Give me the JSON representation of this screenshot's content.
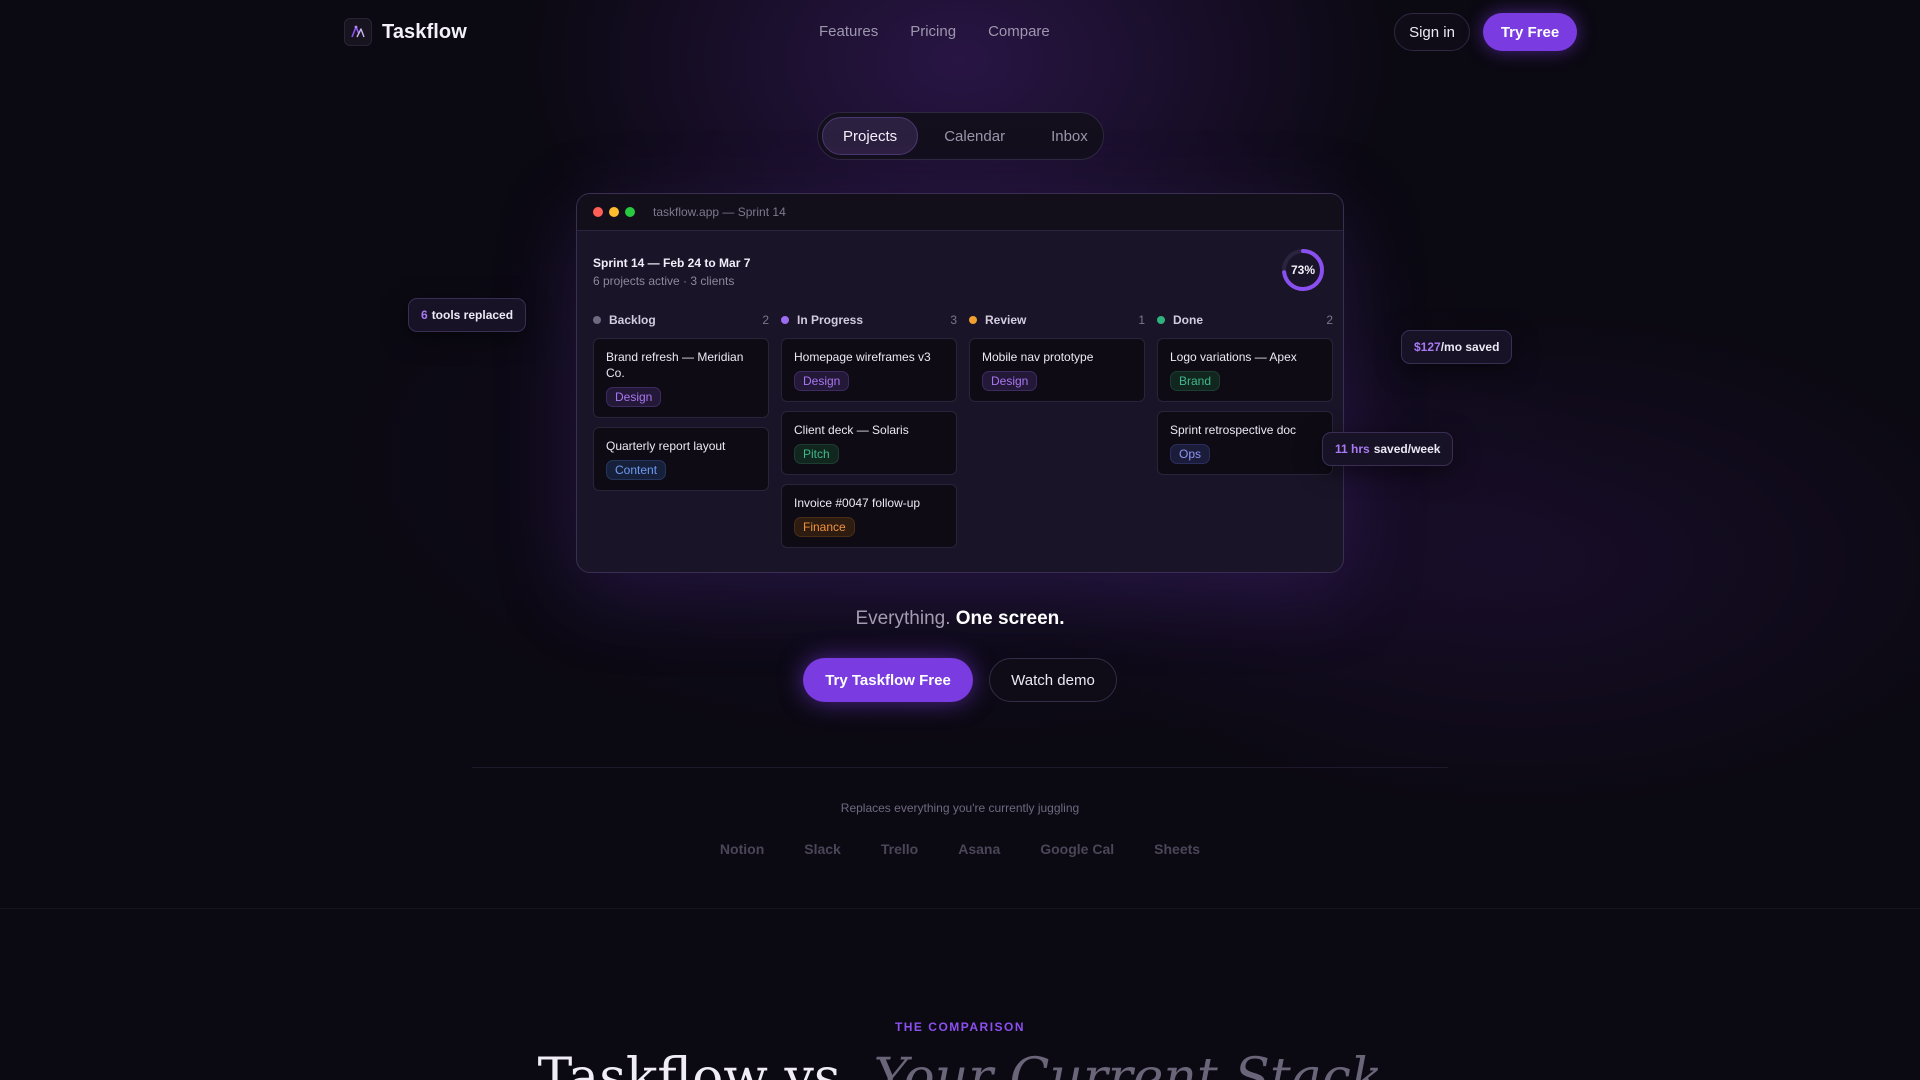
{
  "brand": {
    "name": "Taskflow"
  },
  "nav": {
    "links": [
      "Features",
      "Pricing",
      "Compare"
    ],
    "sign_in": "Sign in",
    "try_free": "Try Free"
  },
  "tabs": [
    {
      "label": "Projects",
      "active": true
    },
    {
      "label": "Calendar",
      "active": false
    },
    {
      "label": "Inbox",
      "active": false
    }
  ],
  "window": {
    "title": "taskflow.app — Sprint 14",
    "sprint_title": "Sprint 14 — Feb 24 to Mar 7",
    "sprint_sub": "6 projects active · 3 clients",
    "progress_label": "73%",
    "progress_value": 0.73,
    "columns": [
      {
        "name": "Backlog",
        "count": "2",
        "color": "#6e6880",
        "cards": [
          {
            "title": "Brand refresh — Meridian Co.",
            "tag": "Design",
            "tag_type": "design"
          },
          {
            "title": "Quarterly report layout",
            "tag": "Content",
            "tag_type": "content"
          }
        ]
      },
      {
        "name": "In Progress",
        "count": "3",
        "color": "#9c6cf0",
        "cards": [
          {
            "title": "Homepage wireframes v3",
            "tag": "Design",
            "tag_type": "design"
          },
          {
            "title": "Client deck — Solaris",
            "tag": "Pitch",
            "tag_type": "pitch"
          },
          {
            "title": "Invoice #0047 follow-up",
            "tag": "Finance",
            "tag_type": "finance"
          }
        ]
      },
      {
        "name": "Review",
        "count": "1",
        "color": "#f0a030",
        "cards": [
          {
            "title": "Mobile nav prototype",
            "tag": "Design",
            "tag_type": "design"
          }
        ]
      },
      {
        "name": "Done",
        "count": "2",
        "color": "#2fb37d",
        "cards": [
          {
            "title": "Logo variations — Apex",
            "tag": "Brand",
            "tag_type": "brand"
          },
          {
            "title": "Sprint retrospective doc",
            "tag": "Ops",
            "tag_type": "ops"
          }
        ]
      }
    ]
  },
  "chips": {
    "tools": {
      "highlight": "6",
      "text": "tools replaced"
    },
    "money": {
      "highlight": "$127",
      "text": "/mo saved"
    },
    "hours": {
      "highlight": "11 hrs",
      "text": "saved/week"
    }
  },
  "hero": {
    "tagline_light": "Everything.",
    "tagline_bold": "One screen.",
    "cta_primary": "Try Taskflow Free",
    "cta_secondary": "Watch demo"
  },
  "replaces": {
    "label": "Replaces everything you're currently juggling",
    "tools": [
      "Notion",
      "Slack",
      "Trello",
      "Asana",
      "Google Cal",
      "Sheets"
    ]
  },
  "comparison": {
    "eyebrow": "THE COMPARISON",
    "title_main": "Taskflow vs.",
    "title_italic": "Your Current Stack"
  },
  "colors": {
    "accent": "#7a3be0",
    "background": "#0b0912",
    "window_dots": [
      "#ff5f57",
      "#febc2e",
      "#28c840"
    ]
  },
  "icons": {
    "logo": "taskflow-logo-icon"
  }
}
